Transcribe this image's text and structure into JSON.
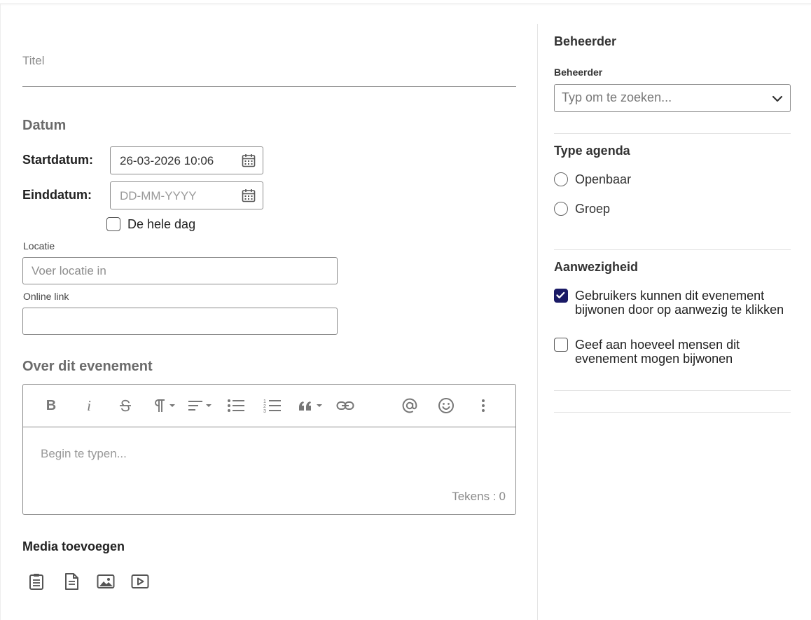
{
  "form": {
    "title_placeholder": "Titel",
    "date_section": "Datum",
    "start_label": "Startdatum:",
    "start_value": "26-03-2026 10:06",
    "end_label": "Einddatum:",
    "end_placeholder": "DD-MM-YYYY",
    "allday_label": "De hele dag",
    "location_label": "Locatie",
    "location_placeholder": "Voer locatie in",
    "online_label": "Online link",
    "online_value": "",
    "about_section": "Over dit evenement",
    "editor_placeholder": "Begin te typen...",
    "counter_label": "Tekens :",
    "counter_value": "0",
    "media_section": "Media toevoegen"
  },
  "toolbar": {
    "bold": "B",
    "italic": "i"
  },
  "sidebar": {
    "owner_section": "Beheerder",
    "owner_label": "Beheerder",
    "owner_placeholder": "Typ om te zoeken...",
    "type_section": "Type agenda",
    "type_options": [
      "Openbaar",
      "Groep"
    ],
    "attendance_section": "Aanwezigheid",
    "attendance_options": [
      {
        "label": "Gebruikers kunnen dit evenement bijwonen door op aanwezig te klikken",
        "checked": true
      },
      {
        "label": "Geef aan hoeveel mensen dit evenement mogen bijwonen",
        "checked": false
      }
    ]
  },
  "colors": {
    "accent": "#1a1a66",
    "border": "#8c8c8c",
    "muted_heading": "#6b6b6b"
  }
}
